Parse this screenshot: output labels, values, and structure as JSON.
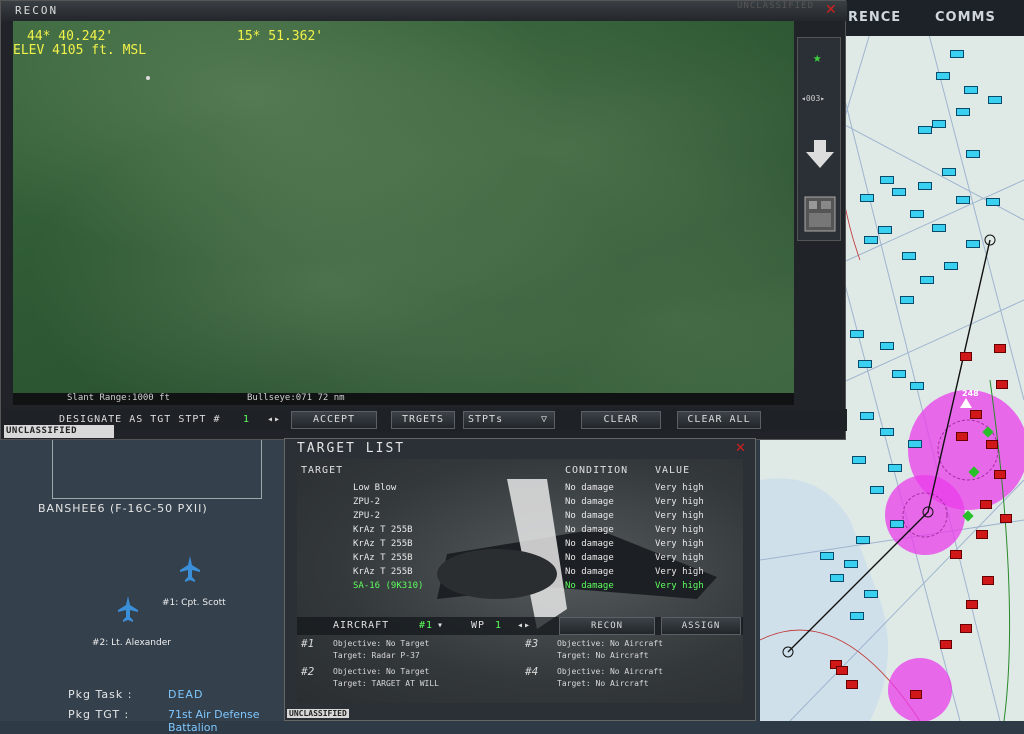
{
  "map": {
    "tabs": [
      "RENCE",
      "COMMS"
    ],
    "labels": [
      "248"
    ]
  },
  "recon": {
    "title": "RECON",
    "classification_top": "UNCLASSIFIED",
    "hud": {
      "lat": "44* 40.242'",
      "lon": "15* 51.362'",
      "elev": "ELEV 4105 ft. MSL"
    },
    "status": {
      "slant_range": "Slant Range:1000 ft",
      "bullseye": "Bullseye:071  72 nm"
    },
    "zoom_label": "003",
    "controls": {
      "designate_label": "DESIGNATE AS TGT STPT #",
      "designate_value": "1",
      "accept": "ACCEPT",
      "targets": "TRGETS",
      "stpts": "STPTs",
      "clear": "CLEAR",
      "clear_all": "CLEAR ALL"
    },
    "classification_bottom": "UNCLASSIFIED"
  },
  "flight": {
    "callsign": "BANSHEE6 (F-16C-50 PXII)",
    "pilots": [
      "#1: Cpt. Scott",
      "#2: Lt. Alexander"
    ],
    "pkg_task_label": "Pkg Task :",
    "pkg_task": "DEAD",
    "pkg_tgt_label": "Pkg TGT  :",
    "pkg_tgt": "71st Air Defense Battalion"
  },
  "target_list": {
    "title": "TARGET LIST",
    "headers": {
      "target": "TARGET",
      "condition": "CONDITION",
      "value": "VALUE"
    },
    "rows": [
      {
        "target": "Low Blow",
        "condition": "No damage",
        "value": "Very high"
      },
      {
        "target": "ZPU-2",
        "condition": "No damage",
        "value": "Very high"
      },
      {
        "target": "ZPU-2",
        "condition": "No damage",
        "value": "Very high"
      },
      {
        "target": "KrAz T 255B",
        "condition": "No damage",
        "value": "Very high"
      },
      {
        "target": "KrAz T 255B",
        "condition": "No damage",
        "value": "Very high"
      },
      {
        "target": "KrAz T 255B",
        "condition": "No damage",
        "value": "Very high"
      },
      {
        "target": "KrAz T 255B",
        "condition": "No damage",
        "value": "Very high"
      },
      {
        "target": "SA-16 (9K310)",
        "condition": "No damage",
        "value": "Very high"
      }
    ],
    "selected_row": 7,
    "aircraft_label": "AIRCRAFT",
    "aircraft_value": "#1",
    "wp_label": "WP",
    "wp_value": "1",
    "recon_button": "RECON",
    "assign_button": "ASSIGN",
    "assignments": [
      {
        "num": "#1",
        "objective": "Objective: No Target",
        "target": "Target: Radar P-37"
      },
      {
        "num": "#2",
        "objective": "Objective: No Target",
        "target": "Target: TARGET AT WILL"
      },
      {
        "num": "#3",
        "objective": "Objective: No Aircraft",
        "target": "Target: No Aircraft"
      },
      {
        "num": "#4",
        "objective": "Objective: No Aircraft",
        "target": "Target: No Aircraft"
      }
    ],
    "classification": "UNCLASSIFIED"
  }
}
